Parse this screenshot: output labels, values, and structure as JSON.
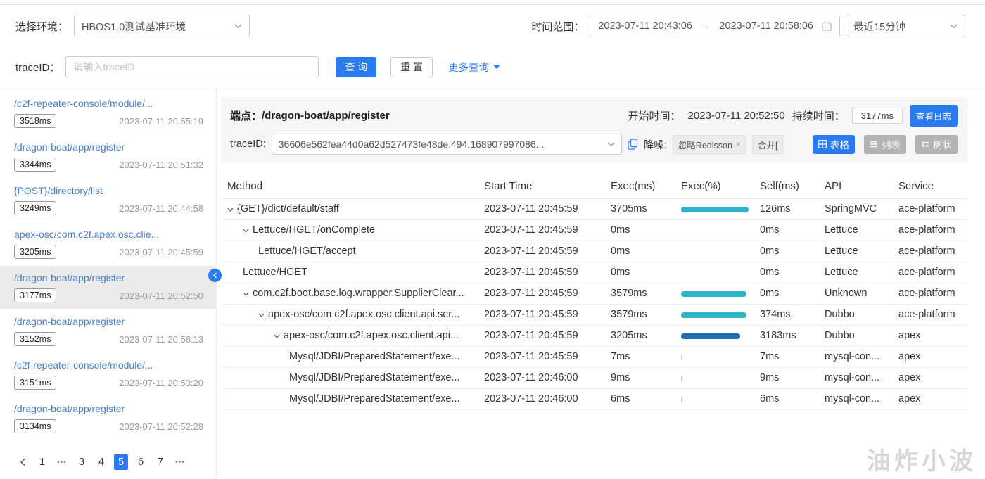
{
  "colors": {
    "accent_blue": "#2a7bf0",
    "bar_teal": "#2fb3c6",
    "bar_dark_blue": "#1f6eb0",
    "bar_minor_gray": "#cdd2d8",
    "link_blue": "#4a7fc1"
  },
  "topbar": {
    "env_label": "选择环境：",
    "env_value": "HBOS1.0测试基准环境",
    "time_label": "时间范围：",
    "time_start": "2023-07-11 20:43:06",
    "time_arrow": "→",
    "time_end": "2023-07-11 20:58:06",
    "time_preset": "最近15分钟",
    "trace_label": "traceID：",
    "trace_placeholder": "请输入traceID",
    "search_button": "查 询",
    "reset_button": "重 置",
    "more_button": "更多查询"
  },
  "sidebar": {
    "selected_index": 4,
    "items": [
      {
        "path": "/c2f-repeater-console/module/...",
        "duration": "3518ms",
        "time": "2023-07-11 20:55:19"
      },
      {
        "path": "/dragon-boat/app/register",
        "duration": "3344ms",
        "time": "2023-07-11 20:51:32"
      },
      {
        "path": "{POST}/directory/list",
        "duration": "3249ms",
        "time": "2023-07-11 20:44:58"
      },
      {
        "path": "apex-osc/com.c2f.apex.osc.clie...",
        "duration": "3205ms",
        "time": "2023-07-11 20:45:59"
      },
      {
        "path": "/dragon-boat/app/register",
        "duration": "3177ms",
        "time": "2023-07-11 20:52:50"
      },
      {
        "path": "/dragon-boat/app/register",
        "duration": "3152ms",
        "time": "2023-07-11 20:56:13"
      },
      {
        "path": "/c2f-repeater-console/module/...",
        "duration": "3151ms",
        "time": "2023-07-11 20:53:20"
      },
      {
        "path": "/dragon-boat/app/register",
        "duration": "3134ms",
        "time": "2023-07-11 20:52:28"
      }
    ],
    "pagination": {
      "items": [
        "1",
        "•••",
        "3",
        "4",
        "5",
        "6",
        "7",
        "•••"
      ],
      "active": "5"
    }
  },
  "detail": {
    "endpoint_label": "端点：",
    "endpoint_value": "/dragon-boat/app/register",
    "start_label": "开始时间：",
    "start_value": "2023-07-11 20:52:50",
    "duration_label": "持续时间：",
    "duration_value": "3177ms",
    "view_log_button": "查看日志",
    "trace_label": "traceID:",
    "trace_value": "36606e562fea44d0a62d527473fe48de.494.168907997086...",
    "noise_label": "降噪:",
    "noise_tag_1": "忽略Redisson",
    "noise_tag_1_close": "×",
    "noise_tag_2": "合并[",
    "view_table": "表格",
    "view_list": "列表",
    "view_tree": "树状"
  },
  "table": {
    "columns": [
      "Method",
      "Start Time",
      "Exec(ms)",
      "Exec(%)",
      "Self(ms)",
      "API",
      "Service"
    ],
    "rows": [
      {
        "method": "{GET}/dict/default/staff",
        "indent": 0,
        "expandable": true,
        "start": "2023-07-11 20:45:59",
        "exec_ms": "3705ms",
        "exec_pct": 100,
        "bar_color": "#2fb3c6",
        "self_ms": "126ms",
        "api": "SpringMVC",
        "service": "ace-platform"
      },
      {
        "method": "Lettuce/HGET/onComplete",
        "indent": 1,
        "expandable": true,
        "start": "2023-07-11 20:45:59",
        "exec_ms": "0ms",
        "exec_pct": 0,
        "bar_color": "",
        "self_ms": "0ms",
        "api": "Lettuce",
        "service": "ace-platform"
      },
      {
        "method": "Lettuce/HGET/accept",
        "indent": 2,
        "expandable": false,
        "start": "2023-07-11 20:45:59",
        "exec_ms": "0ms",
        "exec_pct": 0,
        "bar_color": "",
        "self_ms": "0ms",
        "api": "Lettuce",
        "service": "ace-platform"
      },
      {
        "method": "Lettuce/HGET",
        "indent": 1,
        "expandable": false,
        "start": "2023-07-11 20:45:59",
        "exec_ms": "0ms",
        "exec_pct": 0,
        "bar_color": "",
        "self_ms": "0ms",
        "api": "Lettuce",
        "service": "ace-platform"
      },
      {
        "method": "com.c2f.boot.base.log.wrapper.SupplierClear...",
        "indent": 1,
        "expandable": true,
        "start": "2023-07-11 20:45:59",
        "exec_ms": "3579ms",
        "exec_pct": 97,
        "bar_color": "#2fb3c6",
        "self_ms": "0ms",
        "api": "Unknown",
        "service": "ace-platform"
      },
      {
        "method": "apex-osc/com.c2f.apex.osc.client.api.ser...",
        "indent": 2,
        "expandable": true,
        "start": "2023-07-11 20:45:59",
        "exec_ms": "3579ms",
        "exec_pct": 97,
        "bar_color": "#2fb3c6",
        "self_ms": "374ms",
        "api": "Dubbo",
        "service": "ace-platform"
      },
      {
        "method": "apex-osc/com.c2f.apex.osc.client.api...",
        "indent": 3,
        "expandable": true,
        "start": "2023-07-11 20:45:59",
        "exec_ms": "3205ms",
        "exec_pct": 87,
        "bar_color": "#1f6eb0",
        "self_ms": "3183ms",
        "api": "Dubbo",
        "service": "apex"
      },
      {
        "method": "Mysql/JDBI/PreparedStatement/exe...",
        "indent": 4,
        "expandable": false,
        "start": "2023-07-11 20:45:59",
        "exec_ms": "7ms",
        "exec_pct": 2,
        "bar_color": "#cdd2d8",
        "self_ms": "7ms",
        "api": "mysql-con...",
        "service": "apex"
      },
      {
        "method": "Mysql/JDBI/PreparedStatement/exe...",
        "indent": 4,
        "expandable": false,
        "start": "2023-07-11 20:46:00",
        "exec_ms": "9ms",
        "exec_pct": 2,
        "bar_color": "#cdd2d8",
        "self_ms": "9ms",
        "api": "mysql-con...",
        "service": "apex"
      },
      {
        "method": "Mysql/JDBI/PreparedStatement/exe...",
        "indent": 4,
        "expandable": false,
        "start": "2023-07-11 20:46:00",
        "exec_ms": "6ms",
        "exec_pct": 2,
        "bar_color": "#cdd2d8",
        "self_ms": "6ms",
        "api": "mysql-con...",
        "service": "apex"
      }
    ]
  },
  "watermark": "油炸小波"
}
